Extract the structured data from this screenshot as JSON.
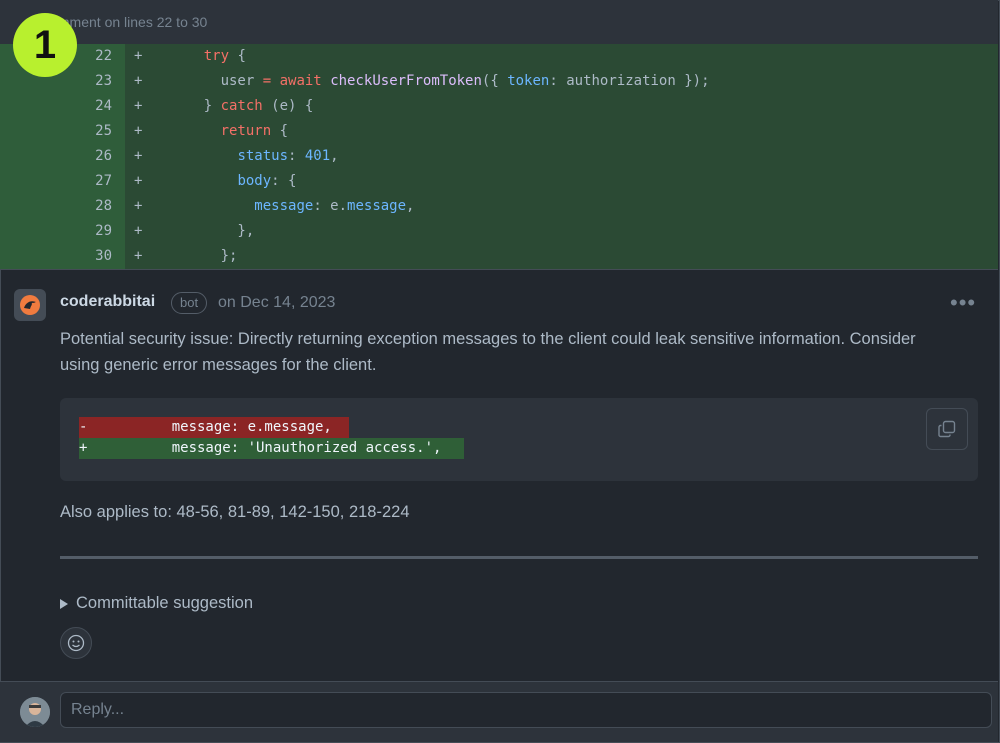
{
  "header": {
    "text": "Comment on lines 22 to 30",
    "badge": "1"
  },
  "code_lines": [
    {
      "num": "22",
      "sign": "+",
      "tokens": [
        {
          "t": "    "
        },
        {
          "t": "try",
          "c": "kw"
        },
        {
          "t": " {"
        }
      ]
    },
    {
      "num": "23",
      "sign": "+",
      "tokens": [
        {
          "t": "      user "
        },
        {
          "t": "=",
          "c": "kw"
        },
        {
          "t": " "
        },
        {
          "t": "await",
          "c": "kw"
        },
        {
          "t": " "
        },
        {
          "t": "checkUserFromToken",
          "c": "fn"
        },
        {
          "t": "({ "
        },
        {
          "t": "token",
          "c": "prop"
        },
        {
          "t": ": authorization });"
        }
      ]
    },
    {
      "num": "24",
      "sign": "+",
      "tokens": [
        {
          "t": "    } "
        },
        {
          "t": "catch",
          "c": "kw"
        },
        {
          "t": " (e) {"
        }
      ]
    },
    {
      "num": "25",
      "sign": "+",
      "tokens": [
        {
          "t": "      "
        },
        {
          "t": "return",
          "c": "kw"
        },
        {
          "t": " {"
        }
      ]
    },
    {
      "num": "26",
      "sign": "+",
      "tokens": [
        {
          "t": "        "
        },
        {
          "t": "status",
          "c": "prop"
        },
        {
          "t": ": "
        },
        {
          "t": "401",
          "c": "num"
        },
        {
          "t": ","
        }
      ]
    },
    {
      "num": "27",
      "sign": "+",
      "tokens": [
        {
          "t": "        "
        },
        {
          "t": "body",
          "c": "prop"
        },
        {
          "t": ": {"
        }
      ]
    },
    {
      "num": "28",
      "sign": "+",
      "tokens": [
        {
          "t": "          "
        },
        {
          "t": "message",
          "c": "prop"
        },
        {
          "t": ": e."
        },
        {
          "t": "message",
          "c": "prop"
        },
        {
          "t": ","
        }
      ]
    },
    {
      "num": "29",
      "sign": "+",
      "tokens": [
        {
          "t": "        },"
        }
      ]
    },
    {
      "num": "30",
      "sign": "+",
      "tokens": [
        {
          "t": "      };"
        }
      ]
    }
  ],
  "comment": {
    "author": "coderabbitai",
    "author_label": "bot",
    "date": "on Dec 14, 2023",
    "more": "•••",
    "body": "Potential security issue: Directly returning exception messages to the client could leak sensitive information. Consider using generic error messages for the client.",
    "suggestion_del": "-          message: e.message,",
    "suggestion_add": "+          message: 'Unauthorized access.',",
    "also_applies": "Also applies to: 48-56, 81-89, 142-150, 218-224",
    "committable": "Committable suggestion"
  },
  "reply": {
    "placeholder": "Reply..."
  },
  "colors": {
    "accent_badge": "#b8f02e",
    "added_bg": "#2b4a34",
    "removed_bg": "#8b2525"
  },
  "icons": {
    "copy": "copy-icon",
    "smiley": "smiley-icon",
    "expand": "triangle-right-icon"
  }
}
